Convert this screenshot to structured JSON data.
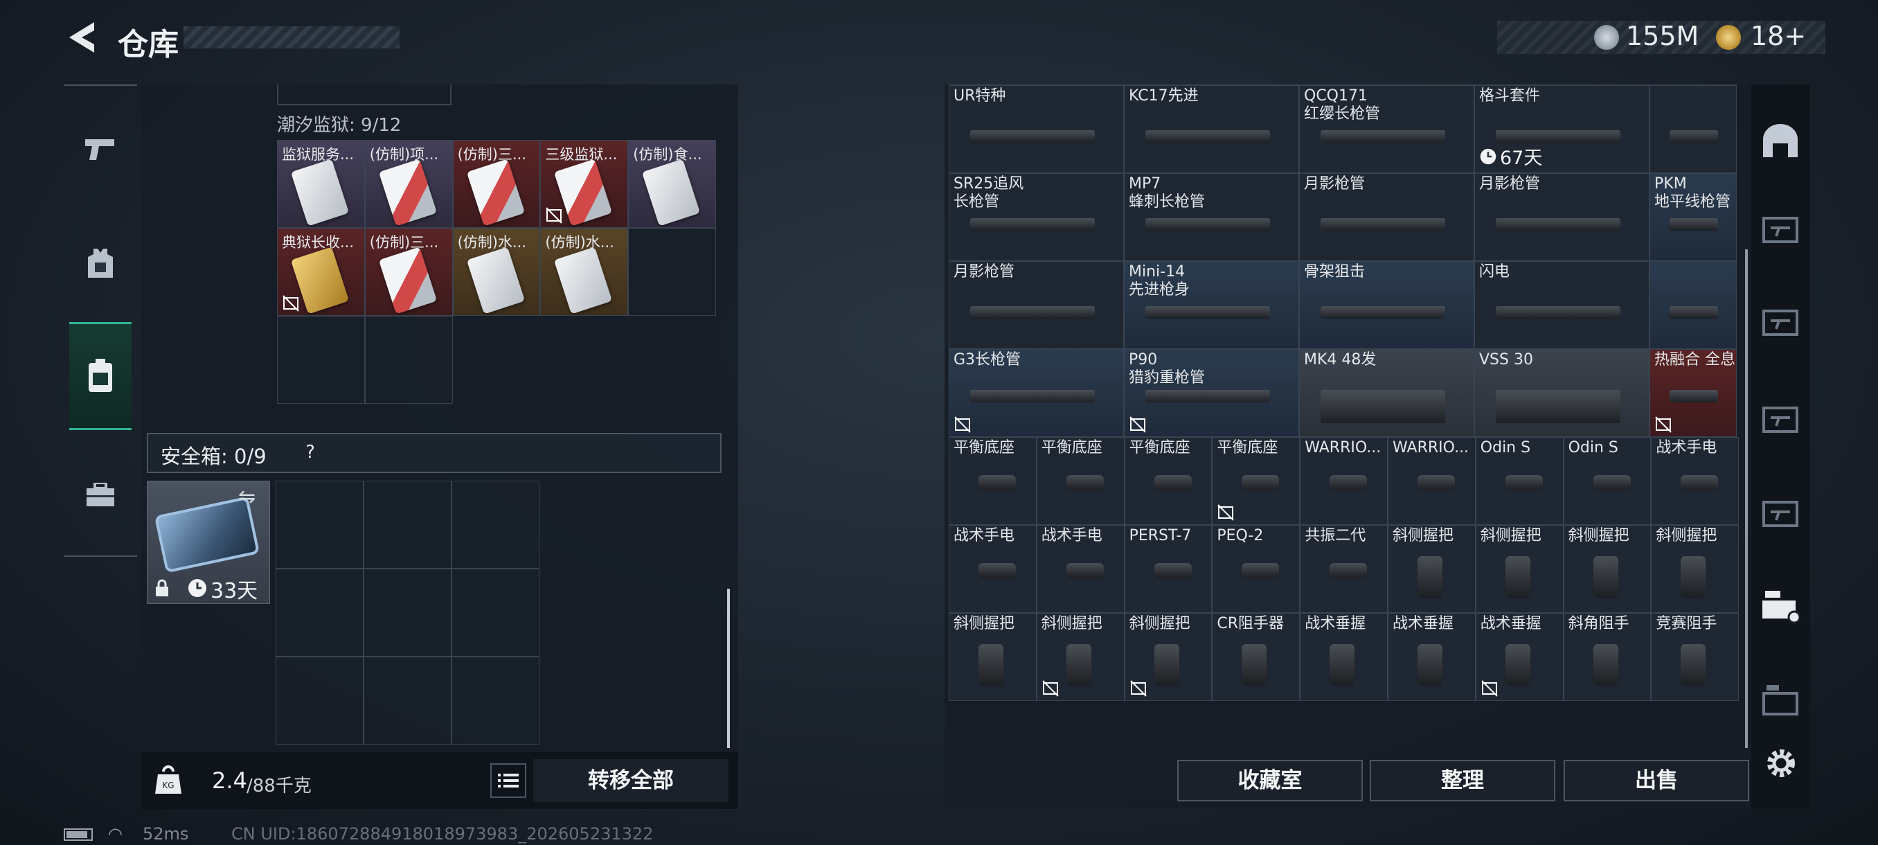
{
  "header": {
    "title": "仓库",
    "currency": [
      {
        "icon": "silver-coin-icon",
        "value": "155M"
      },
      {
        "icon": "gold-coin-icon",
        "value": "18+"
      }
    ]
  },
  "left_nav": [
    {
      "icon": "pistol-icon",
      "active": false
    },
    {
      "icon": "armor-vest-icon",
      "active": false
    },
    {
      "icon": "backpack-icon",
      "active": true
    },
    {
      "icon": "toolbox-icon",
      "active": false
    }
  ],
  "container": {
    "label": "潮汐监狱: 9/12",
    "items": [
      {
        "name": "监狱服务...",
        "color": "purple"
      },
      {
        "name": "(仿制)项...",
        "color": "purple"
      },
      {
        "name": "(仿制)三...",
        "color": "red"
      },
      {
        "name": "三级监狱...",
        "color": "red",
        "marked": true
      },
      {
        "name": "(仿制)食...",
        "color": "purple"
      },
      {
        "name": "典狱长收...",
        "color": "red",
        "marked": true
      },
      {
        "name": "(仿制)三...",
        "color": "red"
      },
      {
        "name": "(仿制)水...",
        "color": "gold"
      },
      {
        "name": "(仿制)水...",
        "color": "gold"
      }
    ]
  },
  "safe_box": {
    "label": "安全箱: 0/9",
    "help": "?",
    "item_timer": "33天"
  },
  "weight": {
    "current": "2.4",
    "max": "/88千克"
  },
  "transfer_all": "转移全部",
  "status": {
    "ping": "52ms",
    "uid": "CN UID:186072884918018973983_202605231322"
  },
  "stash": {
    "rows": [
      [
        {
          "name": "",
          "marked": true
        },
        {
          "name": ""
        },
        {
          "name": ""
        },
        {
          "name": ""
        },
        {
          "name": ""
        }
      ],
      [
        {
          "name": "UR特种"
        },
        {
          "name": "KC17先进"
        },
        {
          "name": "QCQ171\n红缨长枪管"
        },
        {
          "name": "格斗套件",
          "timer": "67天"
        },
        {
          "name": ""
        }
      ],
      [
        {
          "name": "SR25追风\n长枪管"
        },
        {
          "name": "MP7\n蜂刺长枪管"
        },
        {
          "name": "月影枪管"
        },
        {
          "name": "月影枪管"
        },
        {
          "name": "PKM\n地平线枪管"
        }
      ],
      [
        {
          "name": "月影枪管"
        },
        {
          "name": "Mini-14\n先进枪身"
        },
        {
          "name": "骨架狙击"
        },
        {
          "name": "闪电"
        },
        {
          "name": ""
        }
      ],
      [
        {
          "name": "G3长枪管",
          "marked": true
        },
        {
          "name": "P90\n猎豹重枪管",
          "marked": true
        },
        {
          "name": "MK4 48发"
        },
        {
          "name": "VSS 30"
        },
        {
          "name": "热融合 全息",
          "marked": true
        }
      ]
    ],
    "small_rows": [
      [
        "平衡底座",
        "平衡底座",
        "平衡底座",
        "平衡底座",
        "WARRIO...",
        "WARRIO...",
        "Odin S",
        "Odin S",
        "战术手电"
      ],
      [
        "战术手电",
        "战术手电",
        "PERST-7",
        "PEQ-2",
        "共振二代",
        "斜侧握把",
        "斜侧握把",
        "斜侧握把",
        "斜侧握把"
      ],
      [
        "斜侧握把",
        "斜侧握把",
        "斜侧握把",
        "CR阻手器",
        "战术垂握",
        "战术垂握",
        "战术垂握",
        "斜角阻手",
        "竞赛阻手"
      ]
    ]
  },
  "actions": {
    "collection": "收藏室",
    "sort": "整理",
    "sell": "出售"
  },
  "right_nav": [
    "helmet-icon",
    "weapon-case-icon",
    "weapon-case-icon",
    "weapon-case-icon",
    "weapon-case-icon",
    "gti-case-icon",
    "gti-case-icon"
  ]
}
